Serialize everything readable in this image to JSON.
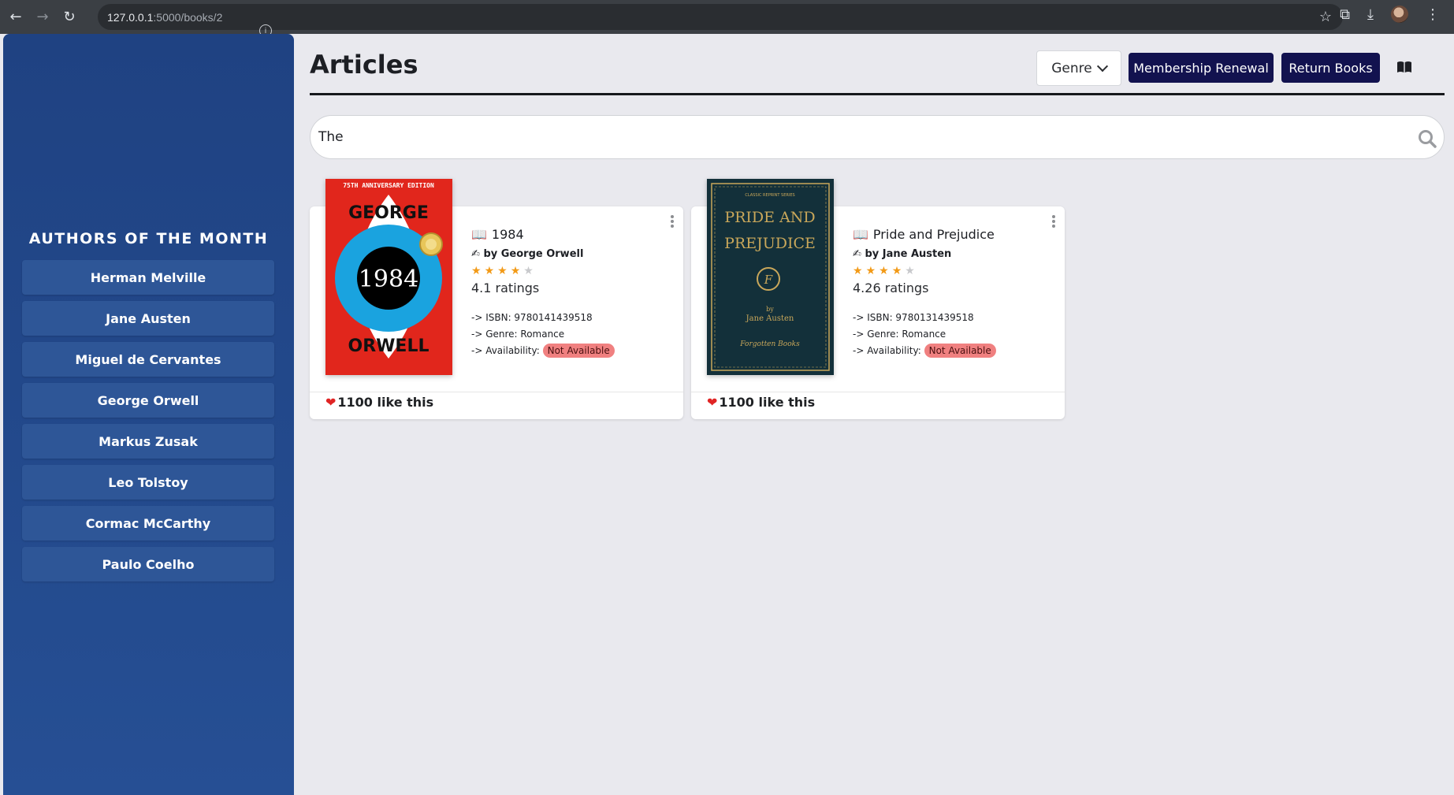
{
  "browser": {
    "url_host": "127.0.0.1",
    "url_path": ":5000/books/2"
  },
  "sidebar": {
    "heading": "AUTHORS OF THE MONTH",
    "authors": [
      "Herman Melville",
      "Jane Austen",
      "Miguel de Cervantes",
      "George Orwell",
      "Markus Zusak",
      "Leo Tolstoy",
      "Cormac McCarthy",
      "Paulo Coelho"
    ]
  },
  "header": {
    "title": "Articles",
    "genre_label": "Genre",
    "membership_label": "Membership Renewal",
    "return_label": "Return Books",
    "book_icon": "book-icon"
  },
  "search": {
    "value": "The",
    "icon": "search-icon"
  },
  "books": [
    {
      "title": "1984",
      "title_icon": "📖",
      "author": "by George Orwell",
      "author_icon": "✍",
      "stars_filled": 4,
      "stars_total": 5,
      "rating": "4.1 ratings",
      "isbn": "-> ISBN: 9780141439518",
      "genre": "-> Genre: Romance",
      "availability_label": "-> Availability:",
      "availability": "Not Available",
      "likes": "1100 like this",
      "cover": {
        "top_text": "75TH ANNIVERSARY EDITION",
        "line1": "GEORGE",
        "center": "1984",
        "line2": "ORWELL",
        "bg": "#e1261c",
        "eye": "#1aa3df"
      }
    },
    {
      "title": "Pride and Prejudice",
      "title_icon": "📖",
      "author": "by Jane Austen",
      "author_icon": "✍",
      "stars_filled": 4,
      "stars_total": 5,
      "rating": "4.26 ratings",
      "isbn": "-> ISBN: 9780131439518",
      "genre": "-> Genre: Romance",
      "availability_label": "-> Availability:",
      "availability": "Not Available",
      "likes": "1100 like this",
      "cover": {
        "top_text": "CLASSIC REPRINT SERIES",
        "line1": "PRIDE AND",
        "line2": "PREJUDICE",
        "byline": "by",
        "author": "Jane Austen",
        "publisher": "Forgotten Books",
        "bg": "#13303a",
        "gold": "#c9a75a"
      }
    }
  ],
  "colors": {
    "sidebar": "#264f94",
    "primary_button": "#12124f",
    "star": "#f29a17",
    "badge": "#f08080"
  }
}
